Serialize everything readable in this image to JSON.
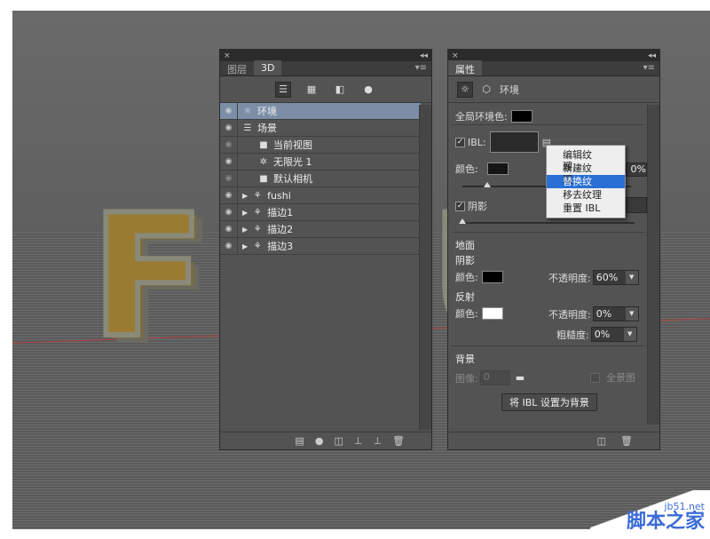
{
  "layers_panel": {
    "tabs": [
      "图层",
      "3D"
    ],
    "collapse": "◂◂",
    "close": "×",
    "tool_icons": [
      "scene-filter-icon",
      "mesh-filter-icon",
      "material-filter-icon",
      "light-filter-icon"
    ],
    "layers": [
      {
        "name": "环境",
        "visible": true,
        "selected": true,
        "icon": "environment-icon",
        "glyph": "☼",
        "indent": 0
      },
      {
        "name": "场景",
        "visible": true,
        "selected": false,
        "icon": "scene-icon",
        "glyph": "☰",
        "indent": 0
      },
      {
        "name": "当前视图",
        "visible": false,
        "selected": false,
        "icon": "camera-icon",
        "glyph": "■",
        "indent": 1
      },
      {
        "name": "无限光 1",
        "visible": true,
        "selected": false,
        "icon": "light-icon",
        "glyph": "✲",
        "indent": 1
      },
      {
        "name": "默认相机",
        "visible": false,
        "selected": false,
        "icon": "camera-icon",
        "glyph": "■",
        "indent": 1
      },
      {
        "name": "fushi",
        "visible": true,
        "selected": false,
        "icon": "mesh-icon",
        "glyph": "⚘",
        "indent": 0,
        "expand": true
      },
      {
        "name": "描边1",
        "visible": true,
        "selected": false,
        "icon": "mesh-icon",
        "glyph": "⚘",
        "indent": 0,
        "expand": true
      },
      {
        "name": "描边2",
        "visible": true,
        "selected": false,
        "icon": "mesh-icon",
        "glyph": "⚘",
        "indent": 0,
        "expand": true
      },
      {
        "name": "描边3",
        "visible": true,
        "selected": false,
        "icon": "mesh-icon",
        "glyph": "⚘",
        "indent": 0,
        "expand": true
      }
    ]
  },
  "props_panel": {
    "tab": "属性",
    "collapse": "◂◂",
    "close": "×",
    "header_title": "环境",
    "global_ambient_label": "全局环境色:",
    "ibl_label": "IBL:",
    "color_label": "颜色:",
    "opacity_partial": "0%",
    "shadow_label": "阴影",
    "ground_label": "地面",
    "ground_shadow_label": "阴影",
    "ground_color_label": "颜色:",
    "ground_opacity_label": "不透明度:",
    "ground_opacity": "60%",
    "reflection_label": "反射",
    "reflection_color_label": "颜色:",
    "reflection_opacity_label": "不透明度:",
    "reflection_opacity": "0%",
    "roughness_label": "粗糙度:",
    "roughness": "0%",
    "background_label": "背景",
    "image_label": "图像:",
    "image_value": "0",
    "panorama_label": "全景图",
    "set_ibl_button": "将 IBL 设置为背景",
    "context_menu": [
      "编辑纹理...",
      "新建纹理...",
      "替换纹理...",
      "移去纹理",
      "重置 IBL"
    ],
    "context_highlight": 2
  },
  "scene_text": {
    "letters": [
      "F",
      "U"
    ]
  },
  "watermark": {
    "line1": "jb51.net",
    "line2": "脚本之家"
  },
  "colors": {
    "selected_row": "#7b8ea6",
    "menu_highlight": "#2a6fd3"
  }
}
